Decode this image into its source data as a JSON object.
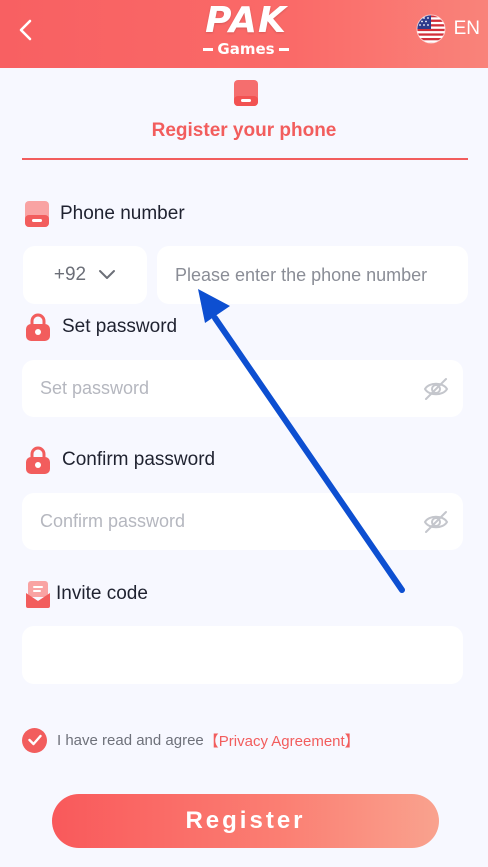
{
  "header": {
    "logo_main": "PAK",
    "logo_sub": "Games",
    "language": "EN",
    "icons": {
      "back": "chevron-left-icon",
      "flag": "us-flag-icon"
    }
  },
  "tab": {
    "title": "Register your phone",
    "icon": "phone-icon"
  },
  "form": {
    "phone": {
      "label": "Phone number",
      "country_code": "+92",
      "placeholder": "Please enter the phone number",
      "icon": "phone-icon"
    },
    "password": {
      "label": "Set password",
      "placeholder": "Set password",
      "icon": "lock-icon"
    },
    "confirm": {
      "label": "Confirm password",
      "placeholder": "Confirm password",
      "icon": "lock-icon"
    },
    "invite": {
      "label": "Invite code",
      "value": "",
      "icon": "invite-icon"
    }
  },
  "agreement": {
    "text": "I have read and agree",
    "link": "【Privacy Agreement】",
    "checked": true
  },
  "register_button": "Register",
  "colors": {
    "accent": "#f25d5d",
    "background": "#f7f8ff",
    "annotation_arrow": "#0d4fd1"
  }
}
